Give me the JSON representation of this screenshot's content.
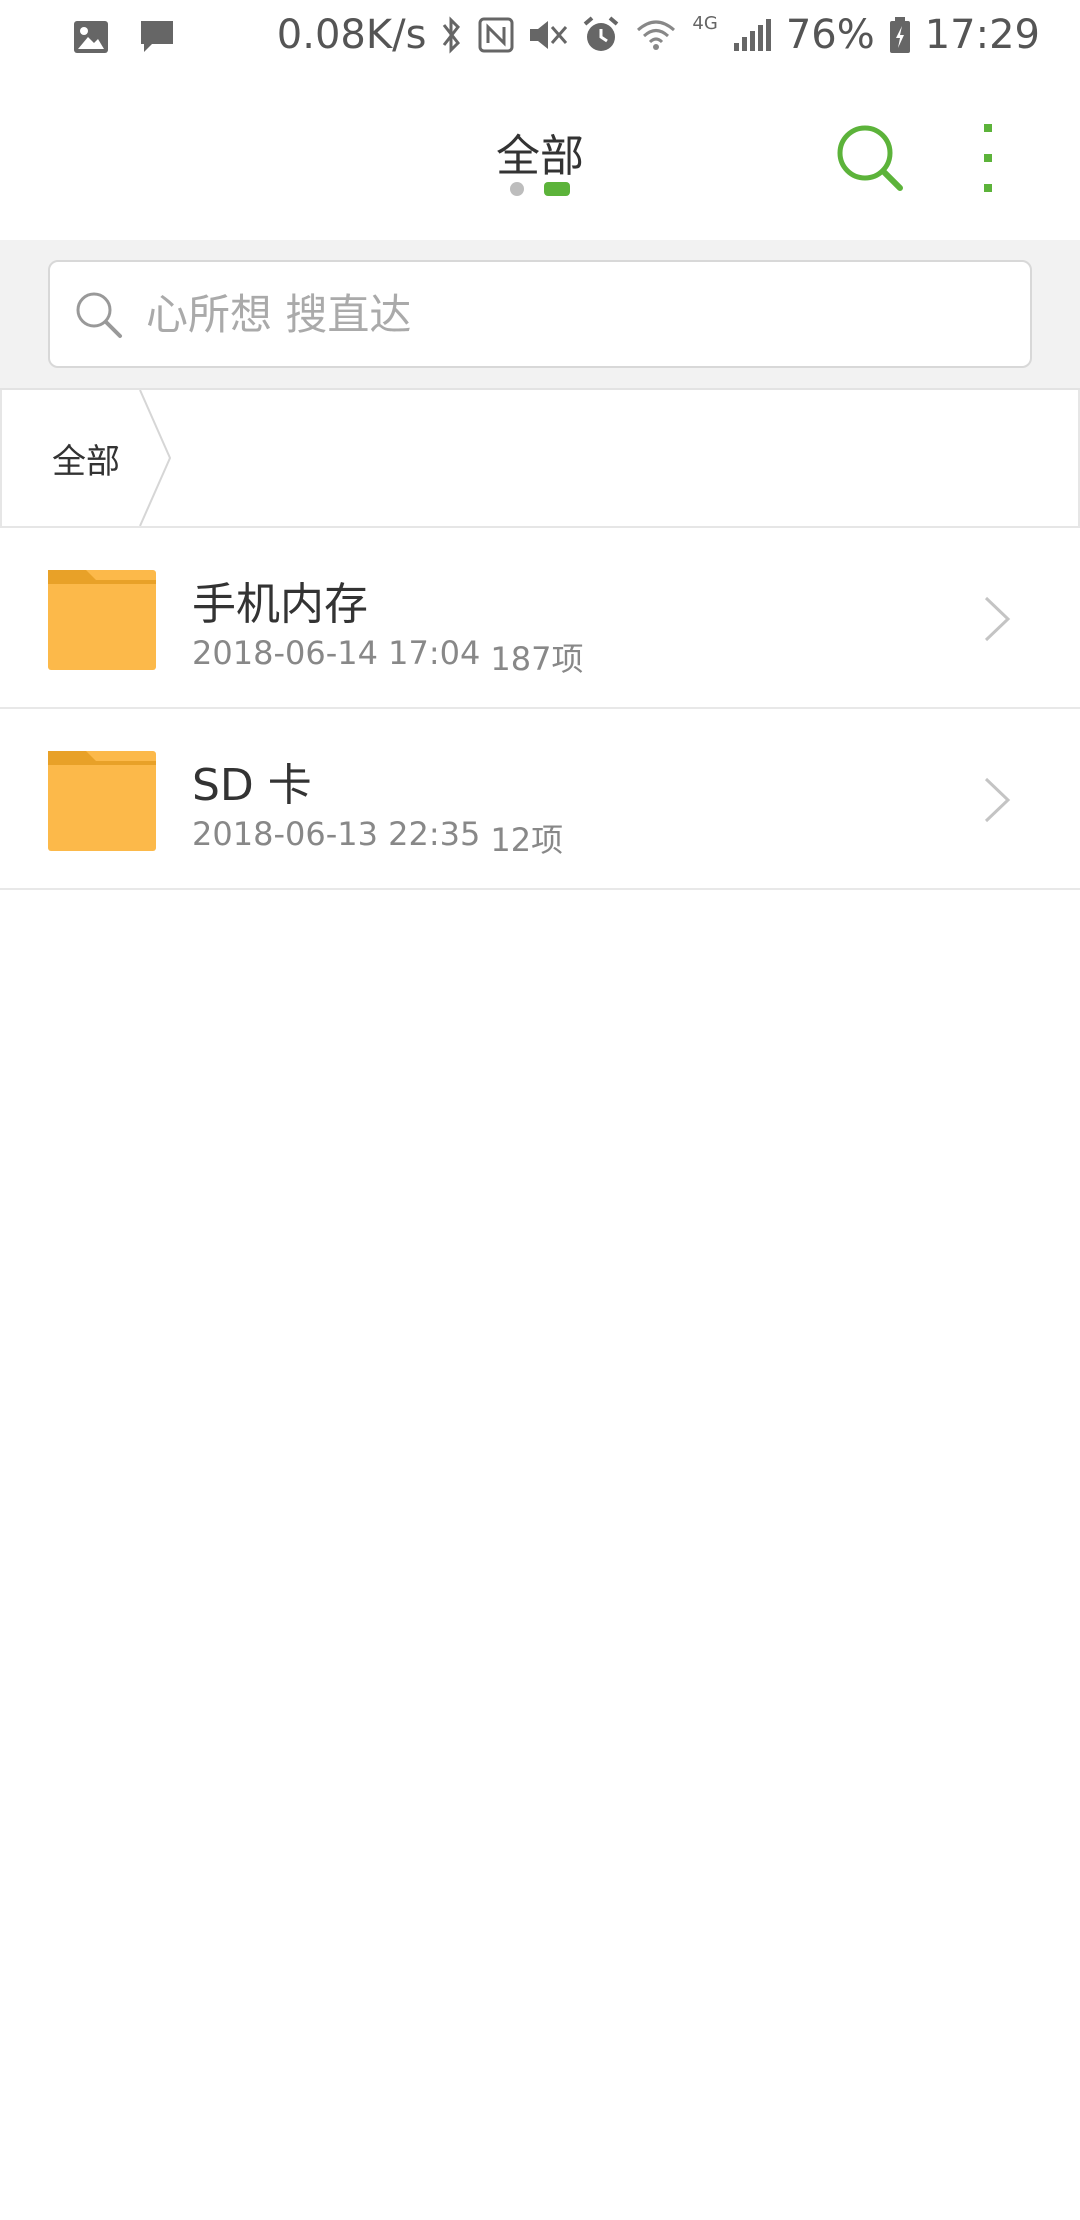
{
  "status_bar": {
    "net_speed": "0.08K/s",
    "network_type": "4G",
    "battery": "76%",
    "time": "17:29",
    "icons": [
      "gallery-icon",
      "message-icon",
      "bluetooth-icon",
      "nfc-icon",
      "mute-icon",
      "alarm-icon",
      "wifi-icon",
      "signal-icon",
      "battery-icon"
    ]
  },
  "app_bar": {
    "title": "全部",
    "page_count": 2,
    "active_page": 2,
    "accent_color": "#5cb33a"
  },
  "search": {
    "placeholder": "心所想 搜直达",
    "value": ""
  },
  "breadcrumb": {
    "items": [
      {
        "label": "全部"
      }
    ]
  },
  "files": [
    {
      "name": "手机内存",
      "date": "2018-06-14 17:04",
      "count": "187项",
      "icon": "folder-icon"
    },
    {
      "name": "SD 卡",
      "date": "2018-06-13 22:35",
      "count": "12项",
      "icon": "folder-icon"
    }
  ],
  "colors": {
    "folder": "#fcb94a",
    "folder_tab": "#e8a128",
    "background": "#ffffff",
    "search_band": "#f2f2f2"
  }
}
